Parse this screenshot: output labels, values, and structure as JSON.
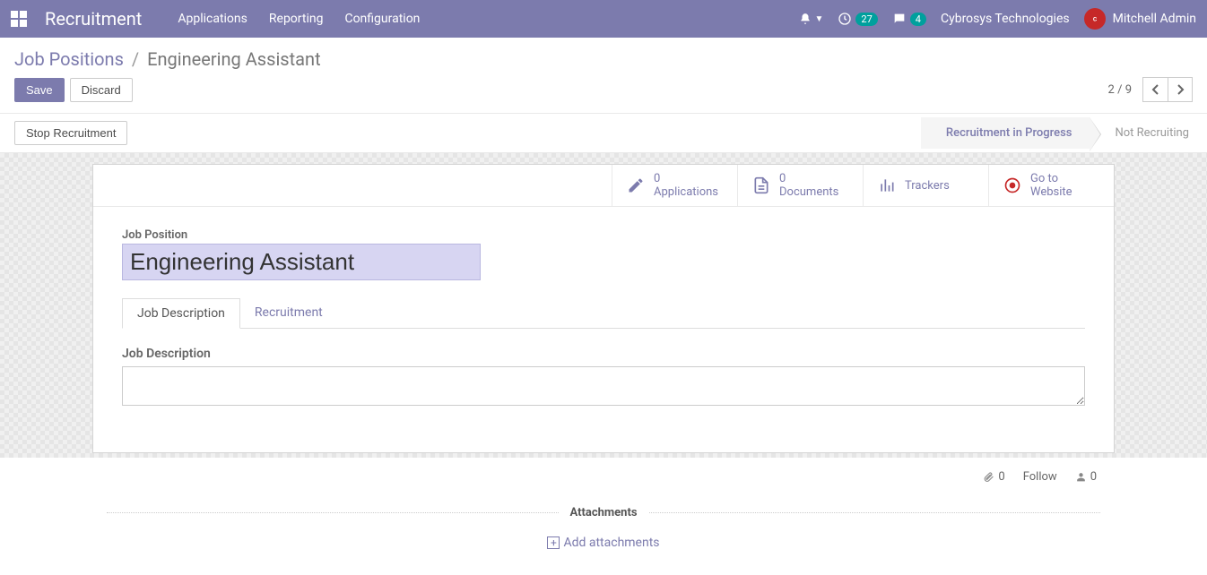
{
  "navbar": {
    "brand": "Recruitment",
    "menu": [
      "Applications",
      "Reporting",
      "Configuration"
    ],
    "activity_count": "27",
    "messages_count": "4",
    "company": "Cybrosys Technologies",
    "user": "Mitchell Admin"
  },
  "breadcrumb": {
    "root": "Job Positions",
    "current": "Engineering Assistant"
  },
  "buttons": {
    "save": "Save",
    "discard": "Discard",
    "stop_recruitment": "Stop Recruitment"
  },
  "pager": {
    "current": "2",
    "total": "9"
  },
  "stages": {
    "in_progress": "Recruitment in Progress",
    "not_recruiting": "Not Recruiting"
  },
  "stat_buttons": {
    "applications": {
      "count": "0",
      "label": "Applications"
    },
    "documents": {
      "count": "0",
      "label": "Documents"
    },
    "trackers": {
      "label": "Trackers"
    },
    "website": {
      "label1": "Go to",
      "label2": "Website"
    }
  },
  "form": {
    "field_label": "Job Position",
    "title_value": "Engineering Assistant",
    "tabs": [
      "Job Description",
      "Recruitment"
    ],
    "section_label": "Job Description",
    "description_value": ""
  },
  "chatter": {
    "attach_count": "0",
    "follow_label": "Follow",
    "follower_count": "0",
    "attachments_title": "Attachments",
    "add_attachments": "Add attachments"
  }
}
